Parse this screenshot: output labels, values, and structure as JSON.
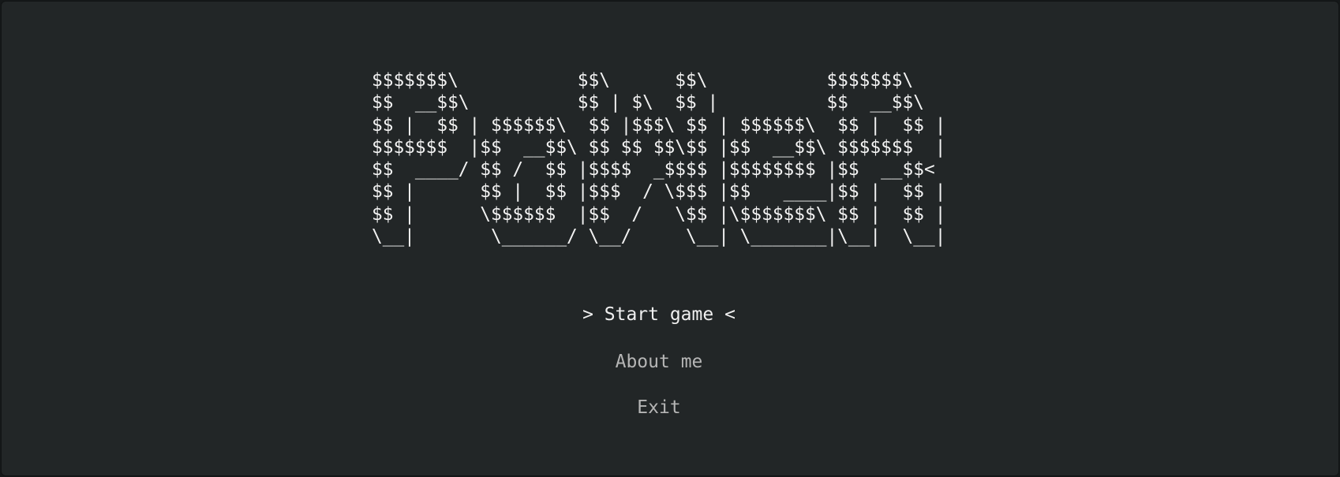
{
  "logo": {
    "lines": [
      "$$$$$$$\\           $$\\      $$\\           $$$$$$$\\  ",
      "$$  __$$\\          $$ | $\\  $$ |          $$  __$$\\ ",
      "$$ |  $$ | $$$$$$\\  $$ |$$$\\ $$ | $$$$$$\\  $$ |  $$ |",
      "$$$$$$$  |$$  __$$\\ $$ $$ $$\\$$ |$$  __$$\\ $$$$$$$  |",
      "$$  ____/ $$ /  $$ |$$$$  _$$$$ |$$$$$$$$ |$$  __$$< ",
      "$$ |      $$ |  $$ |$$$  / \\$$$ |$$   ____|$$ |  $$ |",
      "$$ |      \\$$$$$$  |$$  /   \\$$ |\\$$$$$$$\\ $$ |  $$ |",
      "\\__|       \\______/ \\__/     \\__| \\_______|\\__|  \\__|"
    ]
  },
  "menu": {
    "items": [
      {
        "label": "> Start game <",
        "selected": true
      },
      {
        "label": "About me",
        "selected": false
      },
      {
        "label": "Exit",
        "selected": false
      }
    ]
  },
  "colors": {
    "background": "#222627",
    "selected": "#f0f0f0",
    "unselected": "#b5b5b5"
  }
}
